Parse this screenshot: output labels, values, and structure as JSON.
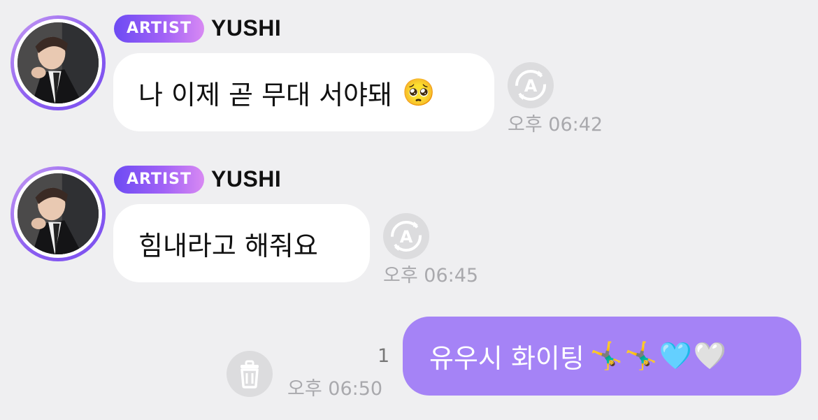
{
  "messages": [
    {
      "badge": "ARTIST",
      "sender": "YUSHI",
      "text": "나 이제 곧 무대 서야돼",
      "emoji": "🥺",
      "time": "오후 06:42"
    },
    {
      "badge": "ARTIST",
      "sender": "YUSHI",
      "text": "힘내라고 해줘요",
      "time": "오후 06:45"
    }
  ],
  "my_message": {
    "text": "유우시 화이팅",
    "emoji": "🤸‍♂️🤸‍♂️🩵🤍",
    "time": "오후 06:50",
    "unread_count": "1"
  },
  "colors": {
    "background": "#efeff1",
    "my_bubble": "#a583f6",
    "badge_start": "#6d4bf3",
    "badge_end": "#d889f3",
    "time_text": "#a9a9ad",
    "icon_bg": "#dcdcde"
  },
  "icons": {
    "translate": "translate-a-icon",
    "delete": "trash-icon"
  }
}
